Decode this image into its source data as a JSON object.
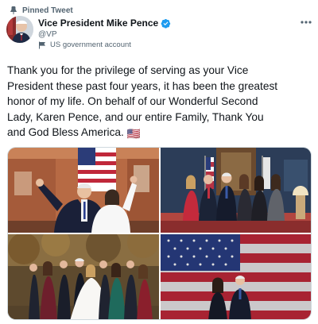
{
  "pinned": {
    "label": "Pinned Tweet",
    "icon": "pin-icon"
  },
  "author": {
    "name": "Vice President Mike Pence",
    "handle": "@VP",
    "verified": true,
    "label_icon": "us-flag-icon",
    "label": "US government account"
  },
  "menu": {
    "icon": "more-icon"
  },
  "tweet": {
    "lines": [
      "Thank you for the privilege of serving as your Vice",
      "President these past four years, it has been the greatest",
      "honor of my life. On behalf of our Wonderful Second",
      "Lady, Karen Pence, and our entire Family, Thank You",
      "and God Bless America."
    ],
    "emoji": "🇺🇸"
  },
  "media": {
    "photos": [
      {
        "name": "photo-couple-waving"
      },
      {
        "name": "photo-group-with-flags"
      },
      {
        "name": "photo-wedding-family"
      },
      {
        "name": "photo-couple-flag-backdrop"
      }
    ]
  },
  "colors": {
    "accent": "#1d9bf0",
    "text": "#0f1419",
    "secondary": "#536471"
  }
}
